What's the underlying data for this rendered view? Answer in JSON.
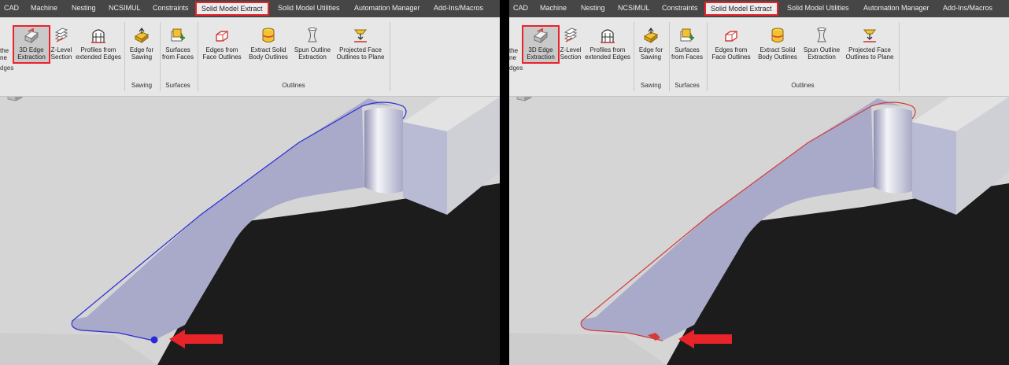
{
  "tabs": [
    "CAD",
    "Machine",
    "Nesting",
    "NCSIMUL",
    "Constraints",
    "Solid Model Extract",
    "Solid Model Utilities",
    "Automation Manager",
    "Add-Ins/Macros"
  ],
  "active_tab": "Solid Model Extract",
  "ribbon": {
    "cut_left_text": {
      "line1": "the",
      "line2": "ne",
      "group": "dges"
    },
    "tools": [
      {
        "line1": "3D Edge",
        "line2": "Extraction"
      },
      {
        "line1": "Z-Level",
        "line2": "Section"
      },
      {
        "line1": "Profiles from",
        "line2": "extended Edges"
      },
      {
        "line1": "Edge for",
        "line2": "Sawing"
      },
      {
        "line1": "Surfaces",
        "line2": "from Faces"
      },
      {
        "line1": "Edges from",
        "line2": "Face Outlines"
      },
      {
        "line1": "Extract Solid",
        "line2": "Body Outlines"
      },
      {
        "line1": "Spun Outline",
        "line2": "Extraction"
      },
      {
        "line1": "Projected Face",
        "line2": "Outlines to Plane"
      }
    ],
    "groups": {
      "sawing": "Sawing",
      "surfaces": "Surfaces",
      "outlines": "Outlines"
    }
  },
  "colors": {
    "highlight": "#e8232a",
    "outline_left": "#2b2bd6",
    "outline_right": "#d43a3a",
    "arrow": "#e8232a",
    "face": "#a9aac9",
    "dark": "#1c1c1c"
  },
  "icons": [
    "3d-edge-icon",
    "z-level-icon",
    "profiles-icon",
    "edge-sawing-icon",
    "surfaces-icon",
    "edges-face-icon",
    "extract-solid-icon",
    "spun-outline-icon",
    "projected-face-icon",
    "view-cube-icon"
  ]
}
